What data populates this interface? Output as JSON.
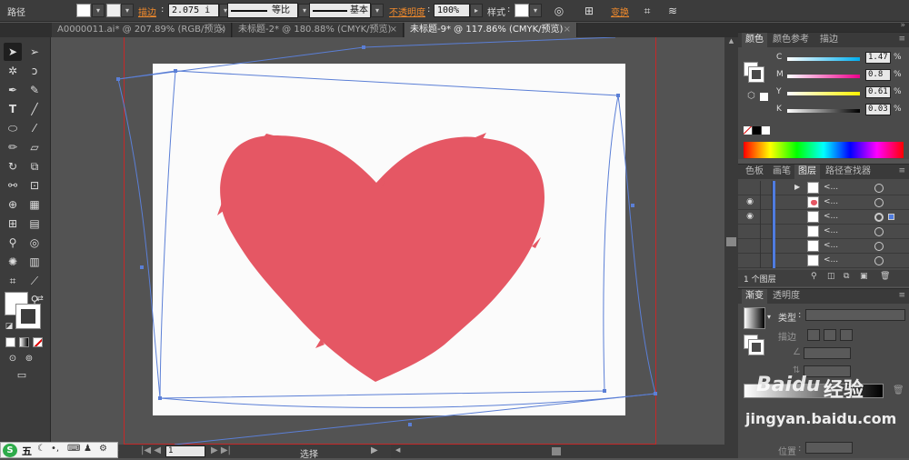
{
  "control_bar": {
    "label": "路径",
    "stroke_label": "描边",
    "stroke_value": "2.075 i",
    "profile_label": "等比",
    "brush_label": "基本",
    "opacity_label": "不透明度",
    "opacity_value": "100%",
    "style_label": "样式",
    "transform_label": "变换"
  },
  "tabs": [
    {
      "label": "A0000011.ai* @ 207.89% (RGB/预览)",
      "close": "×"
    },
    {
      "label": "未标题-2* @ 180.88% (CMYK/预览)",
      "close": "×"
    },
    {
      "label": "未标题-9* @ 117.86% (CMYK/预览)",
      "close": "×"
    }
  ],
  "status": {
    "zoom": "86",
    "page": "1",
    "selection": "选择"
  },
  "color_panel": {
    "tabs": [
      "颜色",
      "颜色参考",
      "描边"
    ],
    "channels": [
      {
        "name": "C",
        "value": "1.47",
        "unit": "%",
        "color": "#00aeef",
        "level": 0.0147
      },
      {
        "name": "M",
        "value": "0.8",
        "unit": "%",
        "color": "#ec008c",
        "level": 0.008
      },
      {
        "name": "Y",
        "value": "0.61",
        "unit": "%",
        "color": "#fff200",
        "level": 0.0061
      },
      {
        "name": "K",
        "value": "0.03",
        "unit": "%",
        "color": "#000000",
        "level": 0.0003
      }
    ]
  },
  "layers_panel": {
    "tabs": [
      "色板",
      "画笔",
      "图层",
      "路径查找器"
    ],
    "rows": [
      {
        "name": "<...",
        "thumb": "white"
      },
      {
        "name": "<...",
        "thumb": "heart"
      },
      {
        "name": "<...",
        "thumb": "white"
      },
      {
        "name": "<...",
        "thumb": "white"
      },
      {
        "name": "<...",
        "thumb": "white"
      },
      {
        "name": "<...",
        "thumb": "white"
      }
    ],
    "footer": "1 个图层"
  },
  "gradient_panel": {
    "tabs": [
      "渐变",
      "透明度"
    ],
    "type_label": "类型",
    "stroke_label": "描边",
    "position_label": "位置"
  },
  "watermark": {
    "brand": "Baidu",
    "text": "经验",
    "url": "jingyan.baidu.com"
  },
  "taskbar": {
    "ime": "五"
  },
  "colors": {
    "heart": "#e55764",
    "path": "#5b7fd6",
    "artboard_border": "#c62828"
  }
}
